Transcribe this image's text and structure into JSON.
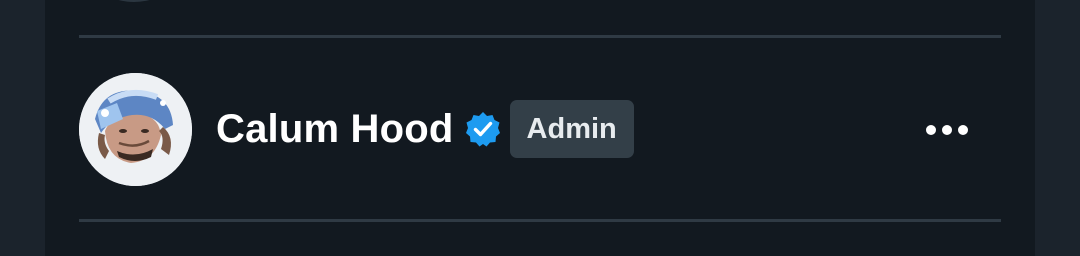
{
  "member": {
    "name": "Calum Hood",
    "verified": true,
    "role_badge": "Admin",
    "avatar_icon": "profile-photo",
    "more_icon": "more-horizontal-icon"
  },
  "colors": {
    "background": "#121920",
    "badge_background": "#333f48",
    "verified_blue": "#1d9bf0",
    "divider": "#2f3a44"
  }
}
